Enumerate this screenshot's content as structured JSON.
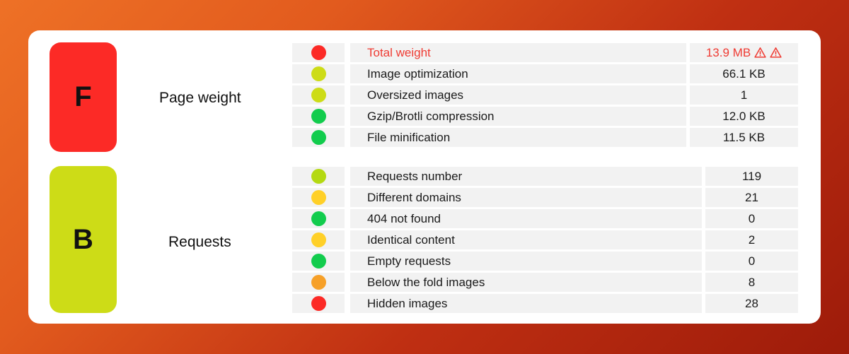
{
  "theme": {
    "background_start": "#ee7126",
    "background_end": "#9d1b0a",
    "card_background": "#ffffff",
    "row_background": "#f2f2f2",
    "alert_text": "#ef3b33"
  },
  "sections": [
    {
      "key": "page_weight",
      "grade": "F",
      "grade_color": "#fc2a26",
      "title": "Page weight",
      "rows": [
        {
          "status_color": "#fc2a26",
          "status": "red",
          "label": "Total weight",
          "value": "13.9 MB",
          "alert": true,
          "warnings": 2
        },
        {
          "status_color": "#cddc17",
          "status": "yellow-green",
          "label": "Image optimization",
          "value": "66.1 KB",
          "alert": false,
          "warnings": 0
        },
        {
          "status_color": "#cddc17",
          "status": "yellow-green",
          "label": "Oversized images",
          "value": "1",
          "alert": false,
          "warnings": 0
        },
        {
          "status_color": "#12cc4d",
          "status": "green",
          "label": "Gzip/Brotli compression",
          "value": "12.0 KB",
          "alert": false,
          "warnings": 0
        },
        {
          "status_color": "#12cc4d",
          "status": "green",
          "label": "File minification",
          "value": "11.5 KB",
          "alert": false,
          "warnings": 0
        }
      ]
    },
    {
      "key": "requests",
      "grade": "B",
      "grade_color": "#cddc17",
      "title": "Requests",
      "rows": [
        {
          "status_color": "#b4d912",
          "status": "yellow-green",
          "label": "Requests number",
          "value": "119",
          "alert": false,
          "warnings": 0
        },
        {
          "status_color": "#ffd028",
          "status": "yellow",
          "label": "Different domains",
          "value": "21",
          "alert": false,
          "warnings": 0
        },
        {
          "status_color": "#12cc4d",
          "status": "green",
          "label": "404 not found",
          "value": "0",
          "alert": false,
          "warnings": 0
        },
        {
          "status_color": "#ffd028",
          "status": "yellow",
          "label": "Identical content",
          "value": "2",
          "alert": false,
          "warnings": 0
        },
        {
          "status_color": "#12cc4d",
          "status": "green",
          "label": "Empty requests",
          "value": "0",
          "alert": false,
          "warnings": 0
        },
        {
          "status_color": "#f6a028",
          "status": "orange",
          "label": "Below the fold images",
          "value": "8",
          "alert": false,
          "warnings": 0
        },
        {
          "status_color": "#fc2a26",
          "status": "red",
          "label": "Hidden images",
          "value": "28",
          "alert": false,
          "warnings": 0
        }
      ]
    }
  ]
}
